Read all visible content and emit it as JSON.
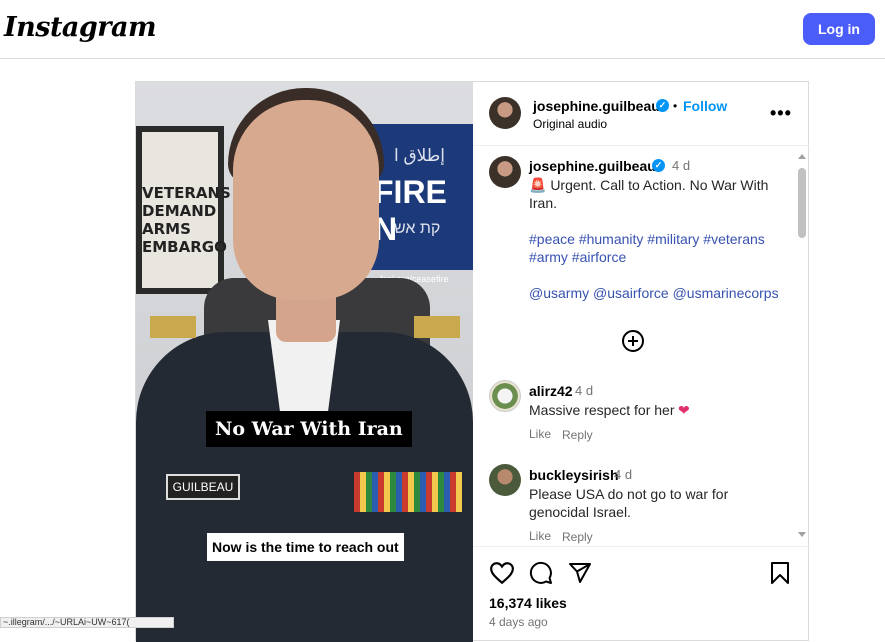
{
  "header": {
    "logo_text": "Instagram",
    "login_label": "Log in"
  },
  "media": {
    "frame_text": "VETERANS DEMAND ARMS EMBARGO",
    "banner_line1": "إطلاق ا",
    "banner_line2": "FIRE N",
    "banner_line3": "קת אש",
    "banner_line4": "fcnl.org/ceasefire",
    "nameplate": "GUILBEAU",
    "caption_top": "No War With Iran",
    "caption_bottom": "Now is the time to reach out"
  },
  "post_header": {
    "username": "josephine.guilbeau",
    "separator": "•",
    "follow_label": "Follow",
    "audio_label": "Original audio",
    "more_label": "•••"
  },
  "caption": {
    "username": "josephine.guilbeau",
    "time": "4 d",
    "line1": "🚨 Urgent. Call to Action. No War With",
    "line2": "Iran.",
    "hashtags_line1": "#peace #humanity #military #veterans",
    "hashtags_line2": "#army #airforce",
    "mentions": "@usarmy @usairforce @usmarinecorps"
  },
  "comments": [
    {
      "username": "alirz42",
      "time": "4 d",
      "text_line1": "Massive respect for her",
      "emoji": "❤",
      "like_label": "Like",
      "reply_label": "Reply"
    },
    {
      "username": "buckleysirish",
      "time": "4 d",
      "text_line1": "Please USA do not go to war for",
      "text_line2": "genocidal Israel.",
      "like_label": "Like",
      "reply_label": "Reply"
    }
  ],
  "stats": {
    "likes": "16,374 likes",
    "time_ago": "4 days ago"
  },
  "status_bar": {
    "url_text": "~.illegram/.../~URLAi~UW~617("
  },
  "colors": {
    "accent": "#4a5df9",
    "link": "#0095f6",
    "hashtag": "#3752b2",
    "muted": "#737373"
  }
}
